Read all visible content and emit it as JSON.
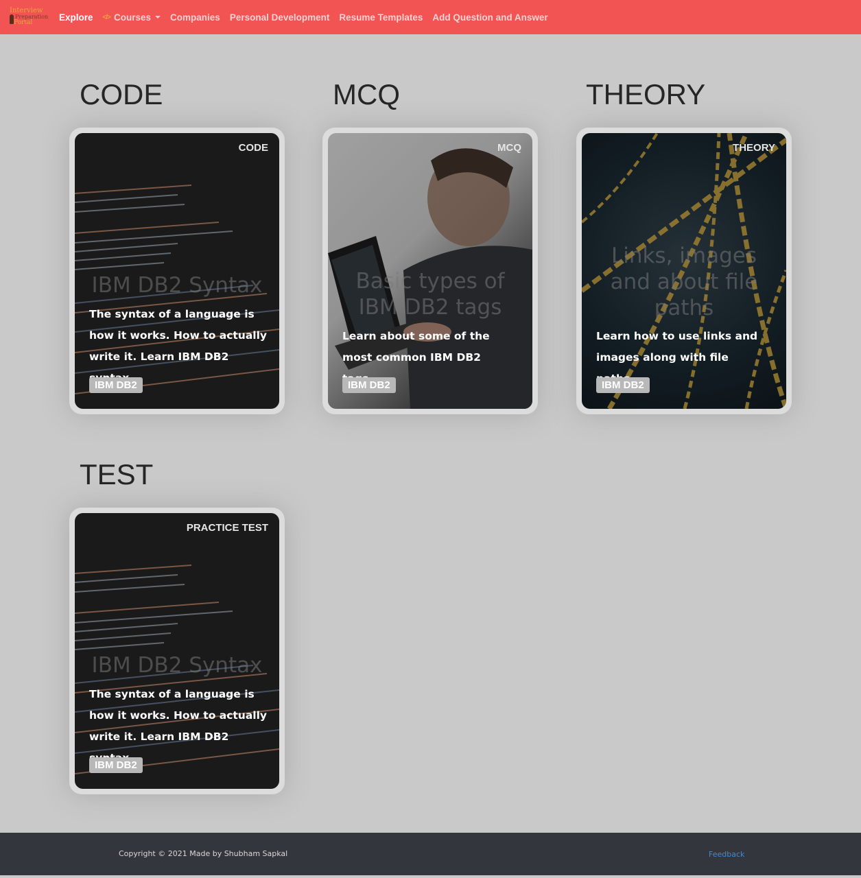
{
  "navbar": {
    "logo_lines": [
      "Interview",
      "Preparation",
      "Portal"
    ],
    "items": [
      "Explore",
      "Courses",
      "Companies",
      "Personal Development",
      "Resume Templates",
      "Add Question and Answer"
    ],
    "courses_icon": "code-icon"
  },
  "sections": [
    {
      "title": "CODE",
      "card": {
        "tag": "CODE",
        "heading": "IBM DB2 Syntax",
        "description": "The syntax of a language is how it works. How to actually write it. Learn IBM DB2 syntax...",
        "badge": "IBM DB2"
      }
    },
    {
      "title": "MCQ",
      "card": {
        "tag": "MCQ",
        "heading": "Basic types of IBM DB2 tags",
        "description": "Learn about some of the most common IBM DB2 tags...",
        "badge": "IBM DB2"
      }
    },
    {
      "title": "THEORY",
      "card": {
        "tag": "THEORY",
        "heading": "Links, images and about file paths",
        "description": "Learn how to use links and images along with file paths...",
        "badge": "IBM DB2"
      }
    },
    {
      "title": "TEST",
      "card": {
        "tag": "PRACTICE TEST",
        "heading": "IBM DB2 Syntax",
        "description": "The syntax of a language is how it works. How to actually write it. Learn IBM DB2 syntax...",
        "badge": "IBM DB2"
      }
    }
  ],
  "footer": {
    "copyright": "Copyright © 2021 Made by Shubham Sapkal",
    "feedback": "Feedback"
  }
}
